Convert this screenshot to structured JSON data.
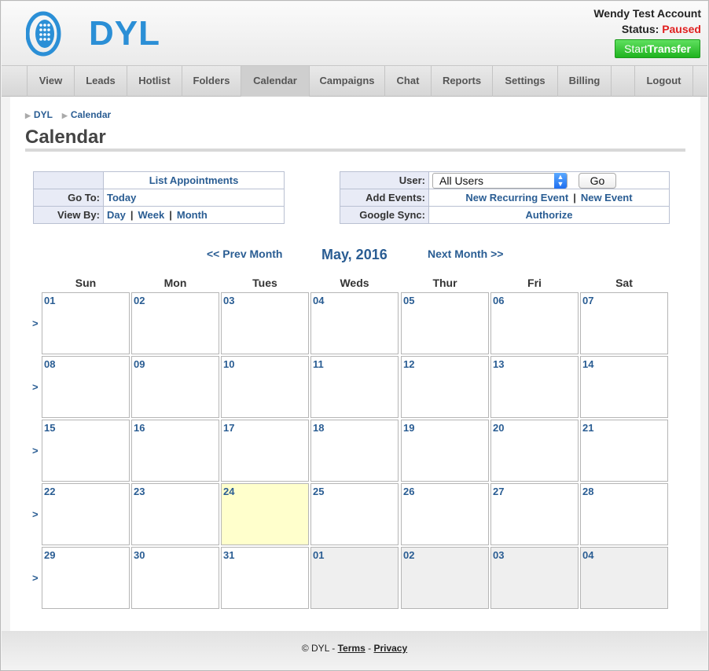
{
  "header": {
    "logo_text": "DYL",
    "account_name": "Wendy Test Account",
    "status_label": "Status:",
    "status_value": "Paused",
    "transfer_start": "Start",
    "transfer_bold": "Transfer"
  },
  "nav": {
    "items": [
      "View",
      "Leads",
      "Hotlist",
      "Folders",
      "Calendar",
      "Campaigns",
      "Chat",
      "Reports",
      "Settings",
      "Billing",
      "",
      "Logout"
    ],
    "active": "Calendar"
  },
  "breadcrumb": [
    "DYL",
    "Calendar"
  ],
  "page_title": "Calendar",
  "left_panel": {
    "list_appointments": "List Appointments",
    "goto_label": "Go To:",
    "today": "Today",
    "viewby_label": "View By:",
    "day": "Day",
    "week": "Week",
    "month": "Month",
    "separator": "|"
  },
  "right_panel": {
    "user_label": "User:",
    "user_value": "All Users",
    "go": "Go",
    "add_events_label": "Add Events:",
    "new_recurring": "New Recurring Event",
    "new_event": "New Event",
    "google_sync_label": "Google Sync:",
    "authorize": "Authorize",
    "separator": "|"
  },
  "month_nav": {
    "prev": "<< Prev Month",
    "title": "May, 2016",
    "next": "Next Month >>"
  },
  "weekdays": [
    "Sun",
    "Mon",
    "Tues",
    "Weds",
    "Thur",
    "Fri",
    "Sat"
  ],
  "week_arrow": ">",
  "weeks": [
    [
      "01",
      "02",
      "03",
      "04",
      "05",
      "06",
      "07"
    ],
    [
      "08",
      "09",
      "10",
      "11",
      "12",
      "13",
      "14"
    ],
    [
      "15",
      "16",
      "17",
      "18",
      "19",
      "20",
      "21"
    ],
    [
      "22",
      "23",
      "24",
      "25",
      "26",
      "27",
      "28"
    ],
    [
      "29",
      "30",
      "31",
      "01",
      "02",
      "03",
      "04"
    ]
  ],
  "today_day": "24",
  "footer": {
    "copyright": "© DYL",
    "dash": "-",
    "terms": "Terms",
    "privacy": "Privacy"
  },
  "colors": {
    "link": "#2a5d93",
    "status_paused": "#e02020",
    "transfer_button": "#2fc22f",
    "today_highlight": "#ffffcc"
  }
}
